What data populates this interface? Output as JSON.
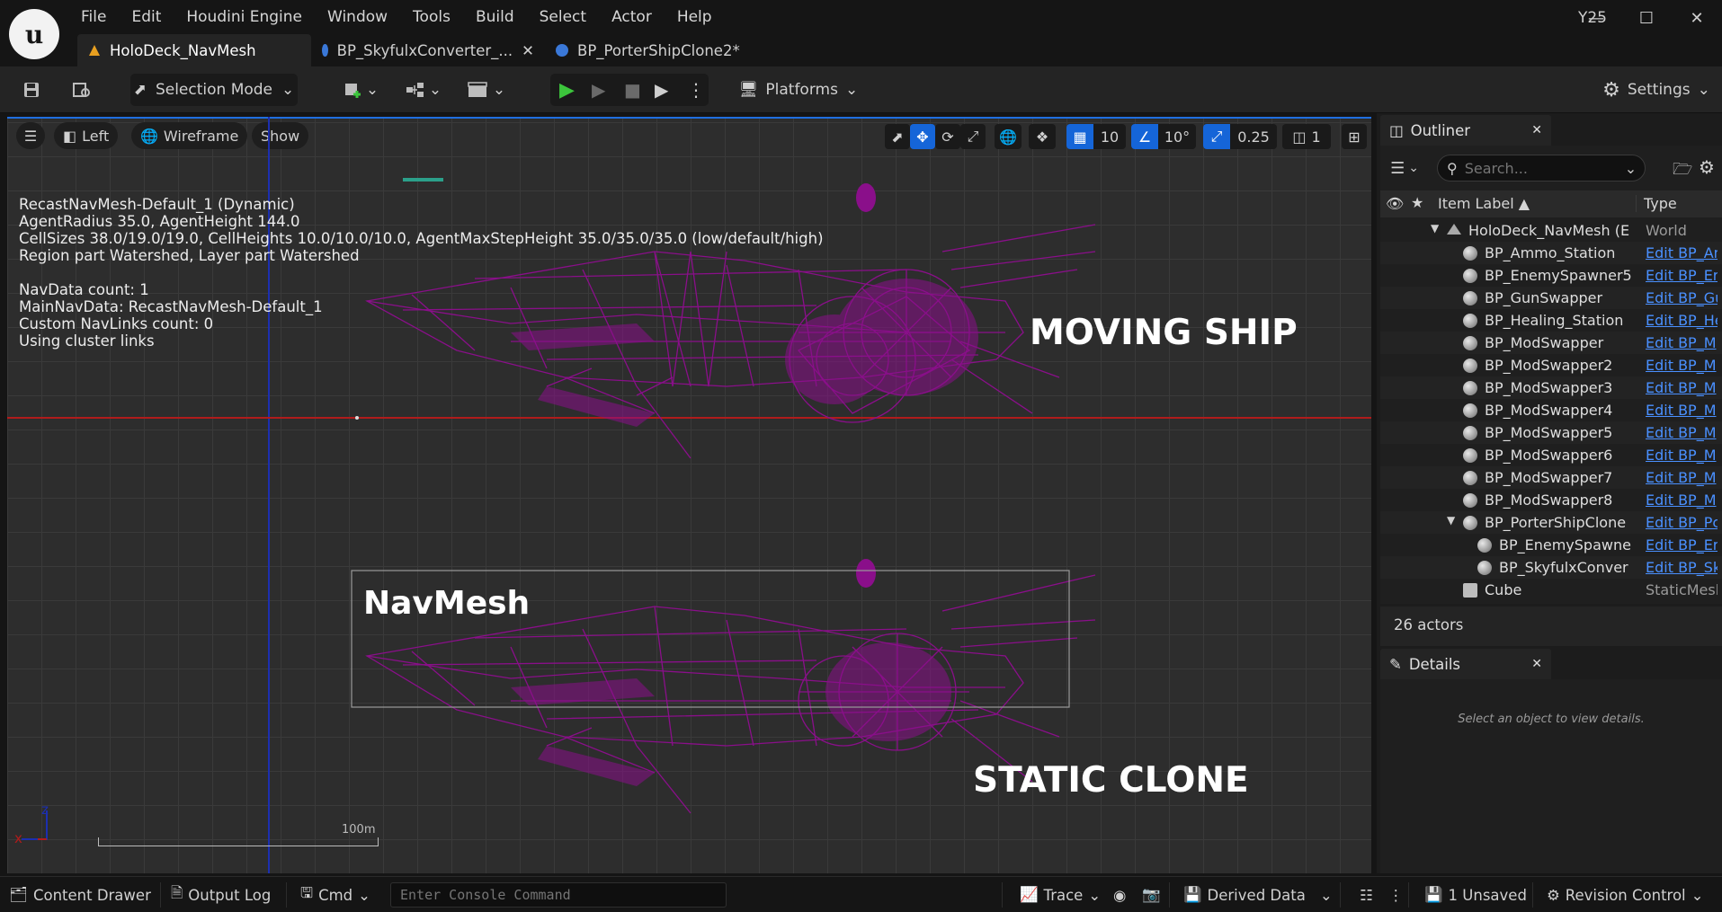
{
  "menu": [
    "File",
    "Edit",
    "Houdini Engine",
    "Window",
    "Tools",
    "Build",
    "Select",
    "Actor",
    "Help"
  ],
  "project_name": "Y25",
  "tabs": [
    {
      "label": "HoloDeck_NavMesh",
      "active": true
    },
    {
      "label": "BP_SkyfulxConverter_...",
      "active": false
    },
    {
      "label": "BP_PorterShipClone2*",
      "active": false
    }
  ],
  "toolbar": {
    "mode": "Selection Mode",
    "platforms": "Platforms",
    "settings": "Settings"
  },
  "viewport": {
    "view": "Left",
    "render": "Wireframe",
    "show": "Show",
    "grid_snap": "10",
    "angle_snap": "10°",
    "scale_snap": "0.25",
    "camera_speed": "1",
    "stats": "RecastNavMesh-Default_1 (Dynamic)\nAgentRadius 35.0, AgentHeight 144.0\nCellSizes 38.0/19.0/19.0, CellHeights 10.0/10.0/10.0, AgentMaxStepHeight 35.0/35.0/35.0 (low/default/high)\nRegion part Watershed, Layer part Watershed\n\nNavData count: 1\nMainNavData: RecastNavMesh-Default_1\nCustom NavLinks count: 0\nUsing cluster links",
    "label_moving": "MOVING SHIP",
    "label_navmesh": "NavMesh",
    "label_static": "STATIC CLONE",
    "scale_label": "100m",
    "axis_z": "z",
    "axis_x": "x",
    "wire_color": "#8a0f8a"
  },
  "outliner": {
    "title": "Outliner",
    "search_placeholder": "Search...",
    "col_label": "Item Label ▲",
    "col_type": "Type",
    "rows": [
      {
        "label": "HoloDeck_NavMesh (E",
        "type": "World",
        "indent": 0,
        "expand": "▼",
        "kind": "world"
      },
      {
        "label": "BP_Ammo_Station",
        "type": "Edit BP_An",
        "indent": 1,
        "kind": "actor"
      },
      {
        "label": "BP_EnemySpawner5",
        "type": "Edit BP_Er",
        "indent": 1,
        "kind": "actor"
      },
      {
        "label": "BP_GunSwapper",
        "type": "Edit BP_Gu",
        "indent": 1,
        "kind": "actor"
      },
      {
        "label": "BP_Healing_Station",
        "type": "Edit BP_He",
        "indent": 1,
        "kind": "actor"
      },
      {
        "label": "BP_ModSwapper",
        "type": "Edit BP_M",
        "indent": 1,
        "kind": "actor"
      },
      {
        "label": "BP_ModSwapper2",
        "type": "Edit BP_M",
        "indent": 1,
        "kind": "actor"
      },
      {
        "label": "BP_ModSwapper3",
        "type": "Edit BP_M",
        "indent": 1,
        "kind": "actor"
      },
      {
        "label": "BP_ModSwapper4",
        "type": "Edit BP_M",
        "indent": 1,
        "kind": "actor"
      },
      {
        "label": "BP_ModSwapper5",
        "type": "Edit BP_M",
        "indent": 1,
        "kind": "actor"
      },
      {
        "label": "BP_ModSwapper6",
        "type": "Edit BP_M",
        "indent": 1,
        "kind": "actor"
      },
      {
        "label": "BP_ModSwapper7",
        "type": "Edit BP_M",
        "indent": 1,
        "kind": "actor"
      },
      {
        "label": "BP_ModSwapper8",
        "type": "Edit BP_M",
        "indent": 1,
        "kind": "actor"
      },
      {
        "label": "BP_PorterShipClone",
        "type": "Edit BP_Pc",
        "indent": 1,
        "expand": "▼",
        "kind": "actor"
      },
      {
        "label": "BP_EnemySpawne",
        "type": "Edit BP_Er",
        "indent": 2,
        "kind": "actor"
      },
      {
        "label": "BP_SkyfulxConver",
        "type": "Edit BP_Sk",
        "indent": 2,
        "kind": "actor"
      },
      {
        "label": "Cube",
        "type": "StaticMesl",
        "indent": 1,
        "kind": "mesh"
      }
    ],
    "actor_count": "26 actors"
  },
  "details": {
    "title": "Details",
    "empty_text": "Select an object to view details."
  },
  "statusbar": {
    "content_drawer": "Content Drawer",
    "output_log": "Output Log",
    "cmd": "Cmd",
    "console_placeholder": "Enter Console Command",
    "trace": "Trace",
    "derived_data": "Derived Data",
    "unsaved": "1 Unsaved",
    "revision_control": "Revision Control"
  }
}
